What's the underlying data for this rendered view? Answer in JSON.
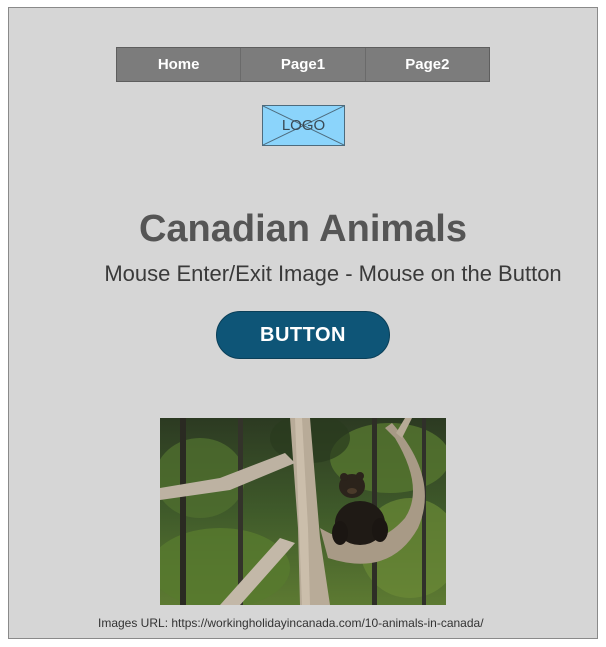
{
  "nav": {
    "items": [
      {
        "label": "Home"
      },
      {
        "label": "Page1"
      },
      {
        "label": "Page2"
      }
    ]
  },
  "logo": {
    "text": "LOGO"
  },
  "header": {
    "title": "Canadian Animals",
    "subtitle": "Mouse Enter/Exit Image - Mouse on the Button"
  },
  "button": {
    "label": "BUTTON"
  },
  "image": {
    "alt": "bear-cub-in-tree"
  },
  "caption": {
    "text": "Images URL: https://workingholidayincanada.com/10-animals-in-canada/"
  },
  "colors": {
    "background": "#d6d6d6",
    "nav": "#7c7c7c",
    "logo": "#8bd4fb",
    "button": "#0e5577",
    "title": "#555555"
  }
}
